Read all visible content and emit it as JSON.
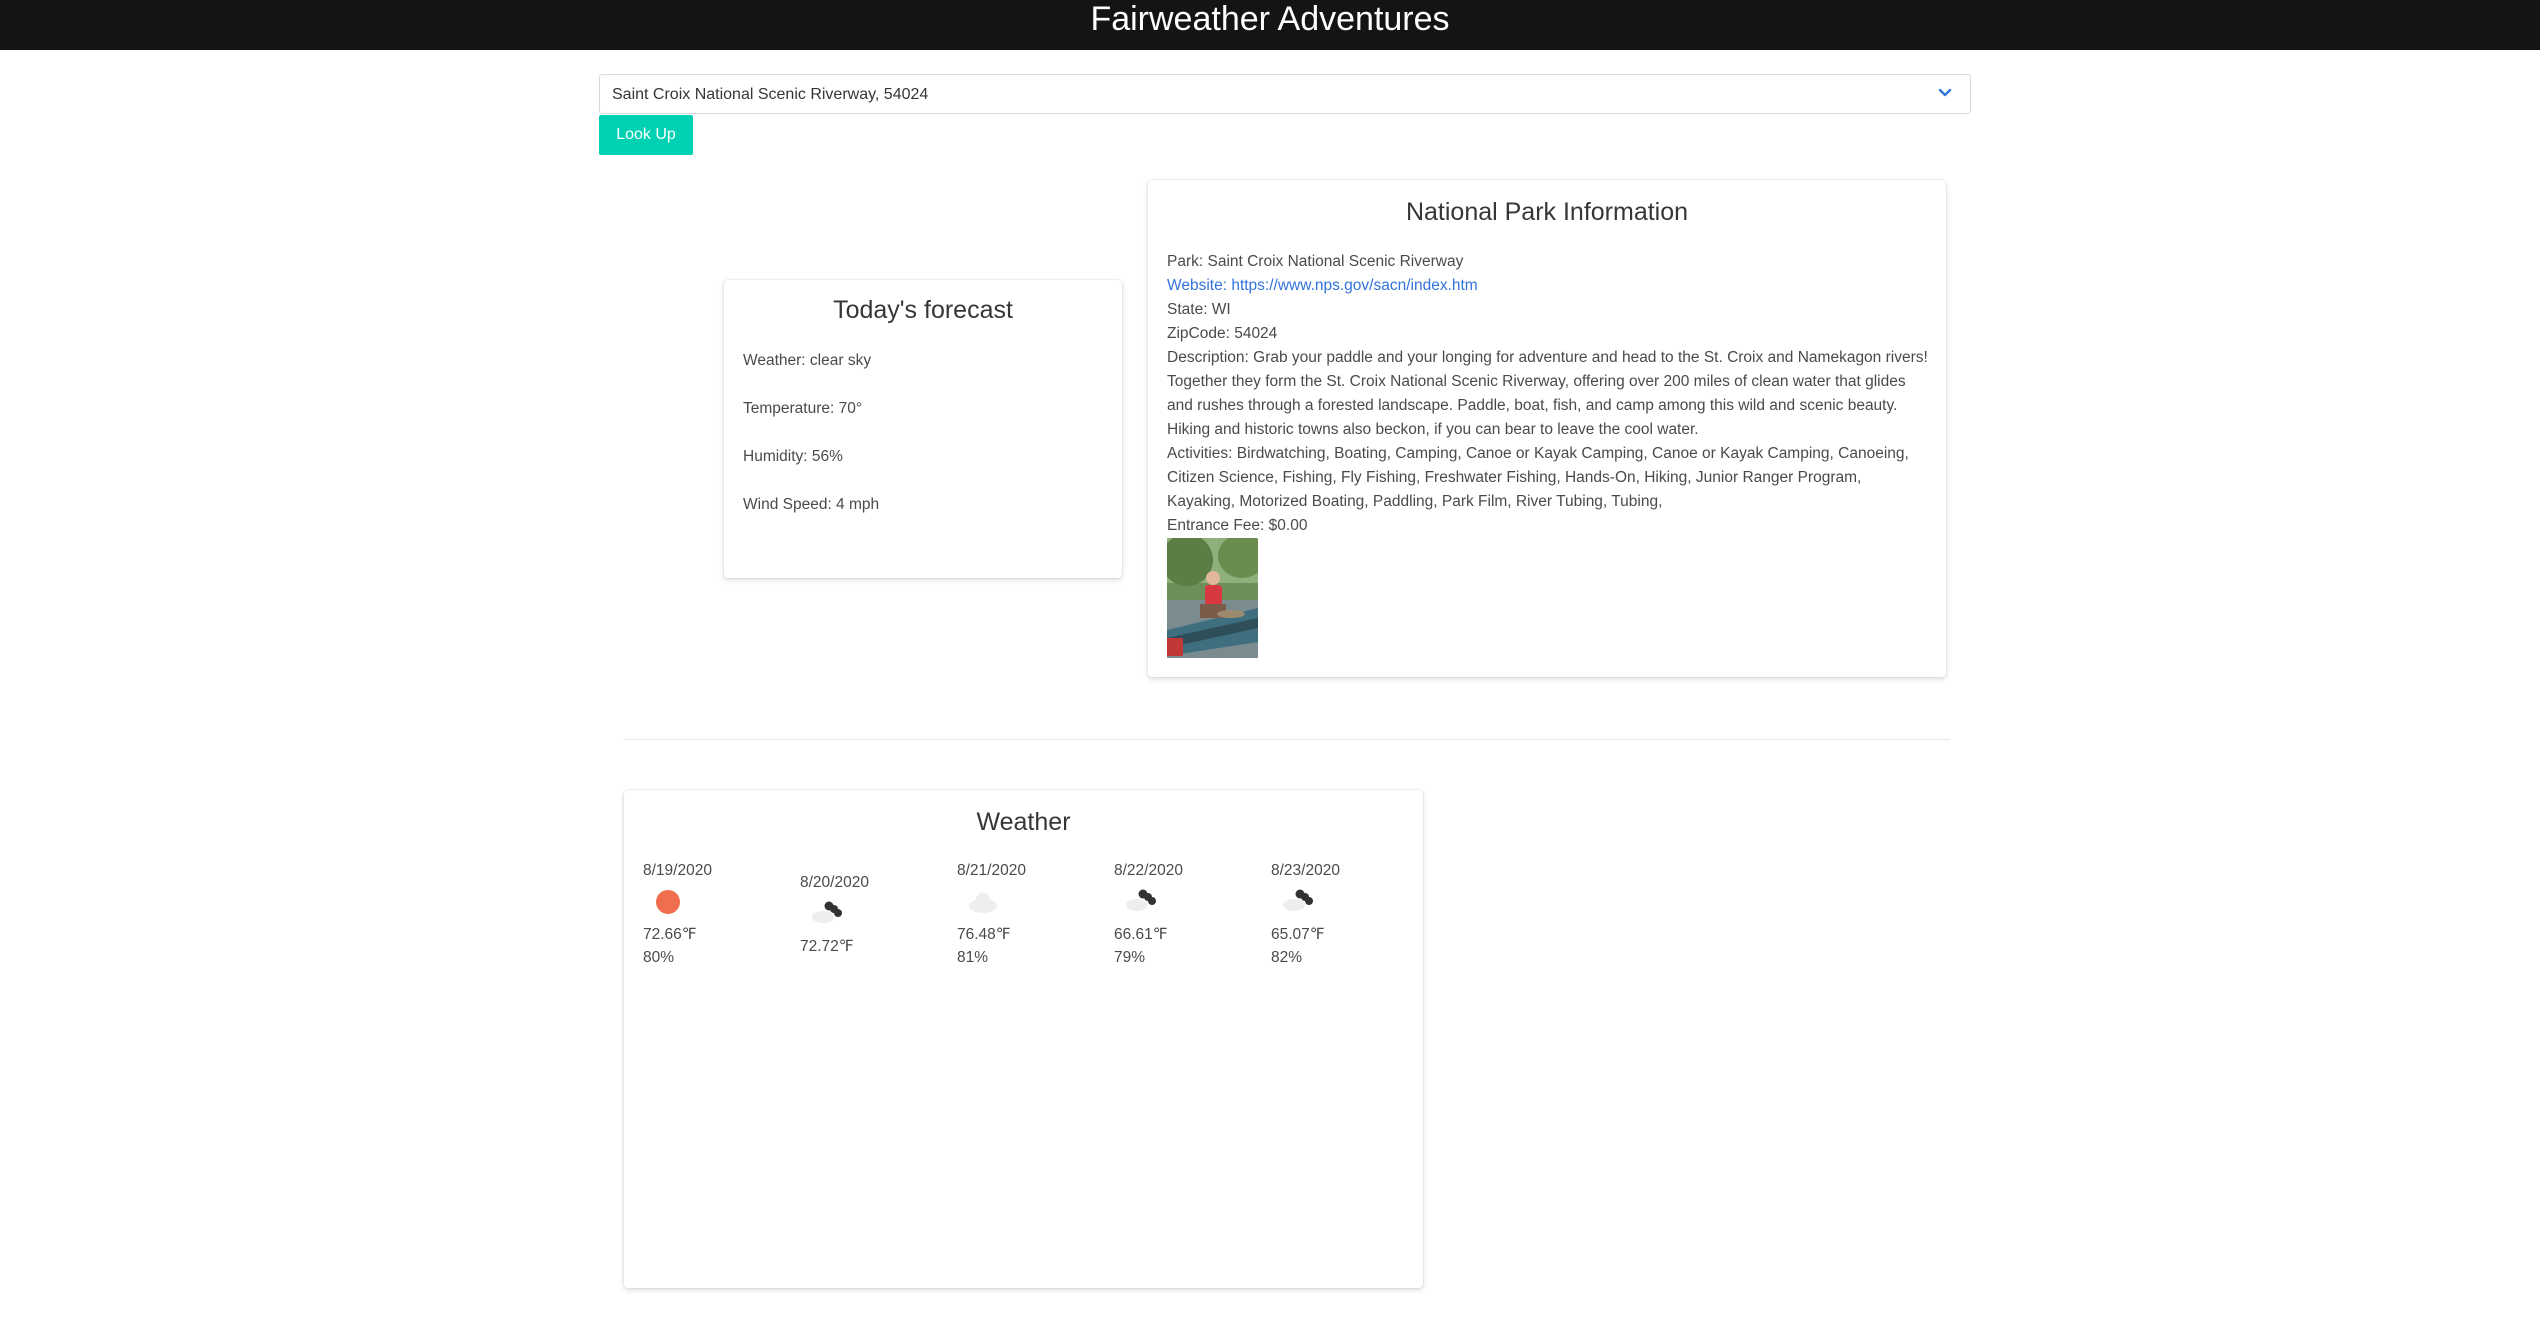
{
  "header": {
    "title": "Fairweather Adventures"
  },
  "search": {
    "selected": "Saint Croix National Scenic Riverway, 54024",
    "button_label": "Look Up"
  },
  "today": {
    "title": "Today's forecast",
    "weather": "Weather: clear sky",
    "temperature": "Temperature: 70°",
    "humidity": "Humidity: 56%",
    "wind": "Wind Speed: 4 mph"
  },
  "park": {
    "title": "National Park Information",
    "name": "Park: Saint Croix National Scenic Riverway",
    "website": "Website: https://www.nps.gov/sacn/index.htm",
    "state": "State: WI",
    "zip": "ZipCode: 54024",
    "description": "Description: Grab your paddle and your longing for adventure and head to the St. Croix and Namekagon rivers! Together they form the St. Croix National Scenic Riverway, offering over 200 miles of clean water that glides and rushes through a forested landscape. Paddle, boat, fish, and camp among this wild and scenic beauty. Hiking and historic towns also beckon, if you can bear to leave the cool water.",
    "activities": "Activities: Birdwatching, Boating, Camping, Canoe or Kayak Camping, Canoe or Kayak Camping, Canoeing, Citizen Science, Fishing, Fly Fishing, Freshwater Fishing, Hands-On, Hiking, Junior Ranger Program, Kayaking, Motorized Boating, Paddling, Park Film, River Tubing, Tubing,",
    "fee": "Entrance Fee: $0.00"
  },
  "weather": {
    "title": "Weather",
    "days": [
      {
        "date": "8/19/2020",
        "icon": "sun-icon",
        "temp": "72.66℉",
        "humidity": "80%"
      },
      {
        "date": "8/20/2020",
        "icon": "broken-clouds-icon",
        "temp": "72.72℉",
        "humidity": ""
      },
      {
        "date": "8/21/2020",
        "icon": "cloud-icon",
        "temp": "76.48℉",
        "humidity": "81%"
      },
      {
        "date": "8/22/2020",
        "icon": "broken-clouds-icon",
        "temp": "66.61℉",
        "humidity": "79%"
      },
      {
        "date": "8/23/2020",
        "icon": "broken-clouds-icon",
        "temp": "65.07℉",
        "humidity": "82%"
      }
    ]
  },
  "colors": {
    "navbar": "#141414",
    "button": "#00d1b2",
    "link": "#3273dc",
    "sun": "#ee6e4d"
  }
}
